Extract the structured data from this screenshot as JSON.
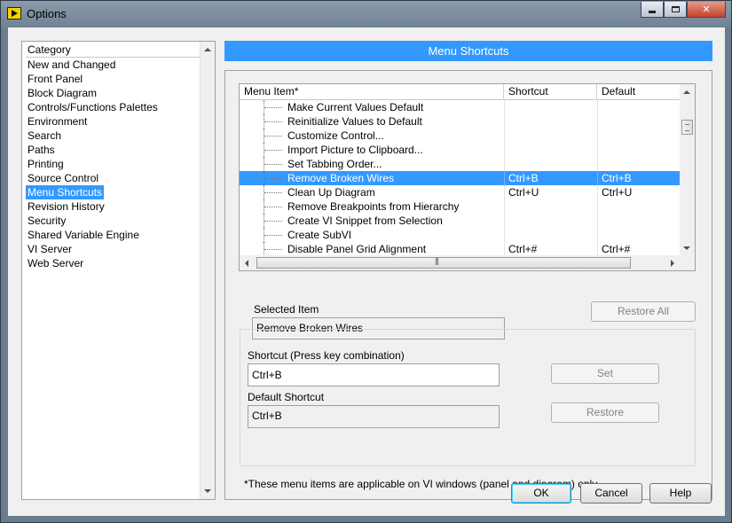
{
  "window": {
    "title": "Options",
    "accent_color": "#3399ff"
  },
  "categories": {
    "header": "Category",
    "items": [
      "New and Changed",
      "Front Panel",
      "Block Diagram",
      "Controls/Functions Palettes",
      "Environment",
      "Search",
      "Paths",
      "Printing",
      "Source Control",
      "Menu Shortcuts",
      "Revision History",
      "Security",
      "Shared Variable Engine",
      "VI Server",
      "Web Server"
    ],
    "selected": "Menu Shortcuts"
  },
  "page": {
    "title": "Menu Shortcuts"
  },
  "shortcuts_table": {
    "columns": [
      "Menu Item*",
      "Shortcut",
      "Default"
    ],
    "rows": [
      {
        "item": "Make Current Values Default",
        "shortcut": "",
        "default": ""
      },
      {
        "item": "Reinitialize Values to Default",
        "shortcut": "",
        "default": ""
      },
      {
        "item": "Customize Control...",
        "shortcut": "",
        "default": ""
      },
      {
        "item": "Import Picture to Clipboard...",
        "shortcut": "",
        "default": ""
      },
      {
        "item": "Set Tabbing Order...",
        "shortcut": "",
        "default": ""
      },
      {
        "item": "Remove Broken Wires",
        "shortcut": "Ctrl+B",
        "default": "Ctrl+B"
      },
      {
        "item": "Clean Up Diagram",
        "shortcut": "Ctrl+U",
        "default": "Ctrl+U"
      },
      {
        "item": "Remove Breakpoints from Hierarchy",
        "shortcut": "",
        "default": ""
      },
      {
        "item": "Create VI Snippet from Selection",
        "shortcut": "",
        "default": ""
      },
      {
        "item": "Create SubVI",
        "shortcut": "",
        "default": ""
      },
      {
        "item": "Disable Panel Grid Alignment",
        "shortcut": "Ctrl+#",
        "default": "Ctrl+#"
      }
    ],
    "selected_index": 5
  },
  "selected_item": {
    "label": "Selected Item",
    "value": "Remove Broken Wires"
  },
  "restore_all_label": "Restore All",
  "shortcut_field": {
    "label": "Shortcut (Press key combination)",
    "value": "Ctrl+B"
  },
  "default_shortcut": {
    "label": "Default Shortcut",
    "value": "Ctrl+B"
  },
  "set_label": "Set",
  "restore_label": "Restore",
  "footnote": "*These menu items are applicable on VI windows (panel and diagram) only.",
  "dialog_buttons": {
    "ok": "OK",
    "cancel": "Cancel",
    "help": "Help"
  }
}
